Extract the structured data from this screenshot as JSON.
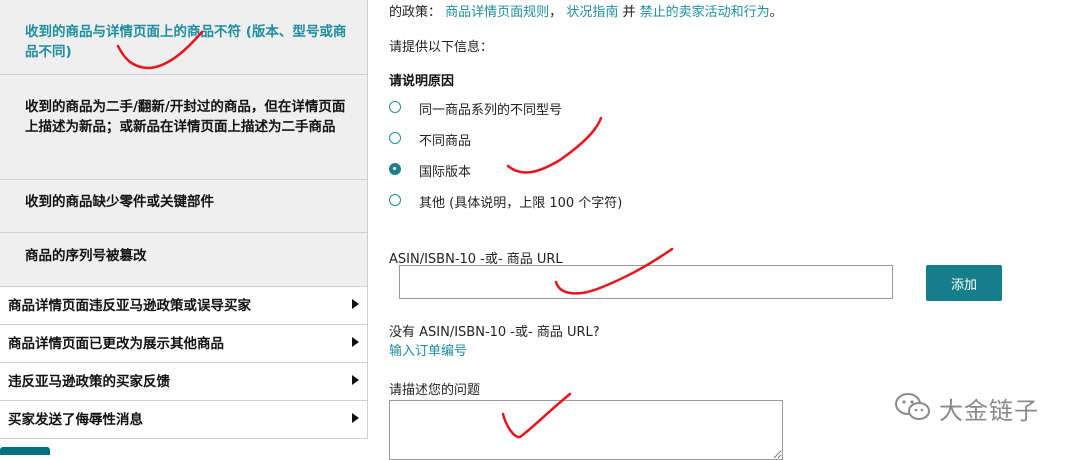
{
  "left_panel": {
    "sub_items": [
      {
        "label": "收到的商品与详情页面上的商品不符 (版本、型号或商品不同)",
        "selected": true
      },
      {
        "label": "收到的商品为二手/翻新/开封过的商品，但在详情页面上描述为新品；或新品在详情页面上描述为二手商品",
        "selected": false
      },
      {
        "label": "收到的商品缺少零件或关键部件",
        "selected": false
      },
      {
        "label": "商品的序列号被篡改",
        "selected": false
      }
    ],
    "main_items": [
      {
        "label": "商品详情页面违反亚马逊政策或误导买家"
      },
      {
        "label": "商品详情页面已更改为展示其他商品"
      },
      {
        "label": "违反亚马逊政策的买家反馈"
      },
      {
        "label": "买家发送了侮辱性消息"
      }
    ]
  },
  "form": {
    "policy_prefix": "的政策：",
    "policy_link1": "商品详情页面规则",
    "policy_sep": "，",
    "policy_link2": "状况指南",
    "policy_and": " 并 ",
    "policy_link3": "禁止的卖家活动和行为",
    "policy_end": "。",
    "provide_info": "请提供以下信息：",
    "reason_title": "请说明原因",
    "reasons": [
      {
        "label": "同一商品系列的不同型号",
        "checked": false
      },
      {
        "label": "不同商品",
        "checked": false
      },
      {
        "label": "国际版本",
        "checked": true
      },
      {
        "label": "其他 (具体说明，上限 100 个字符)",
        "checked": false
      }
    ],
    "asin_label": "ASIN/ISBN-10 -或- 商品 URL",
    "asin_value": "",
    "add_button": "添加",
    "no_asin": "没有 ASIN/ISBN-10 -或- 商品 URL?",
    "order_link": "输入订单编号",
    "describe_label": "请描述您的问题",
    "describe_value": ""
  },
  "watermark": {
    "text": "大金链子",
    "icon": "wechat-icon"
  },
  "colors": {
    "teal": "#167e8b",
    "link": "#1f8ea0",
    "annotation_red": "#e8141c"
  }
}
